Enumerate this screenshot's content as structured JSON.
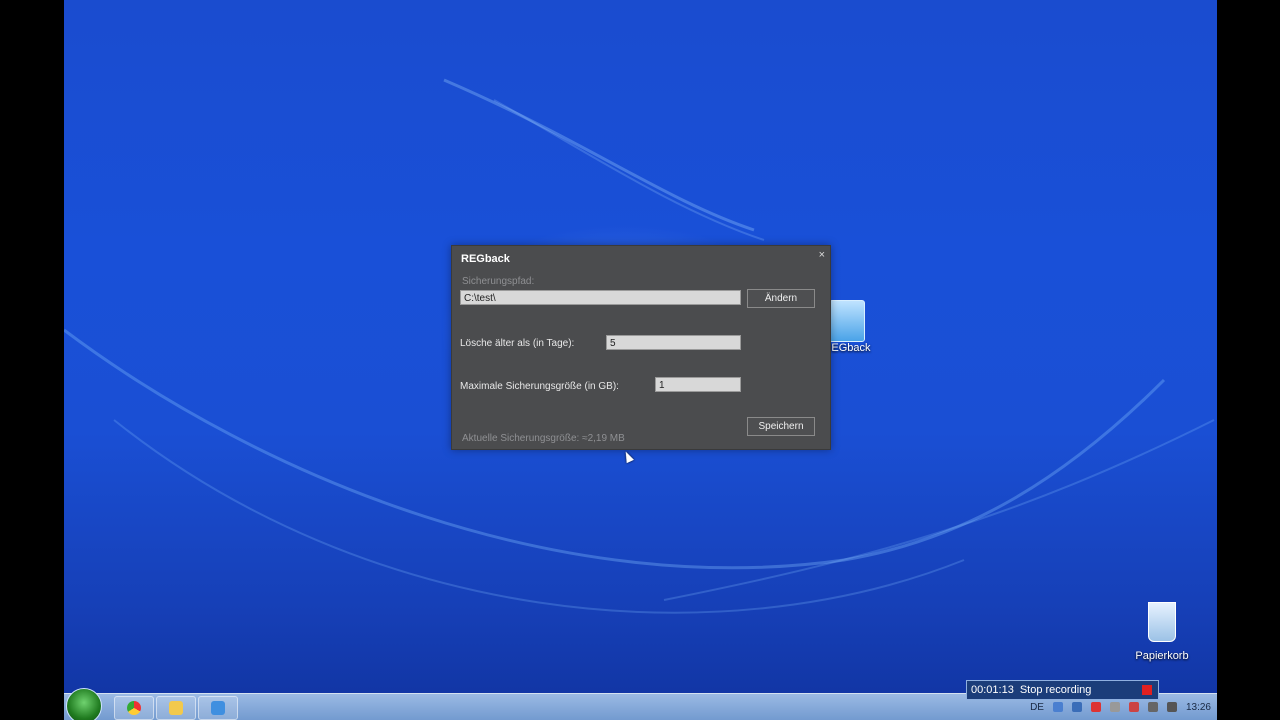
{
  "dialog": {
    "title": "REGback",
    "close_glyph": "×",
    "path_label": "Sicherungspfad:",
    "path_value": "C:\\test\\",
    "change_button": "Ändern",
    "delete_label": "Lösche älter als (in Tage):",
    "delete_value": "5",
    "maxsize_label": "Maximale Sicherungsgröße (in GB):",
    "maxsize_value": "1",
    "save_button": "Speichern",
    "current_size_label": "Aktuelle Sicherungsgröße:",
    "current_size_value": "≈2,19 MB"
  },
  "desktop_icons": [
    {
      "label": "REGback",
      "icon": "regback-app-icon"
    },
    {
      "label": "Papierkorb",
      "icon": "recycle-bin-icon"
    }
  ],
  "taskbar": {
    "pinned": [
      "start-orb",
      "chrome-icon",
      "explorer-folder-icon",
      "regback-taskbar-icon"
    ],
    "language": "DE",
    "clock": "13:26"
  },
  "recorder": {
    "timer": "00:01:13",
    "stop_label": "Stop recording"
  },
  "colors": {
    "dialog_bg": "#4b4c4e",
    "desktop_blue": "#1a4fd4",
    "record_red": "#e02020"
  }
}
